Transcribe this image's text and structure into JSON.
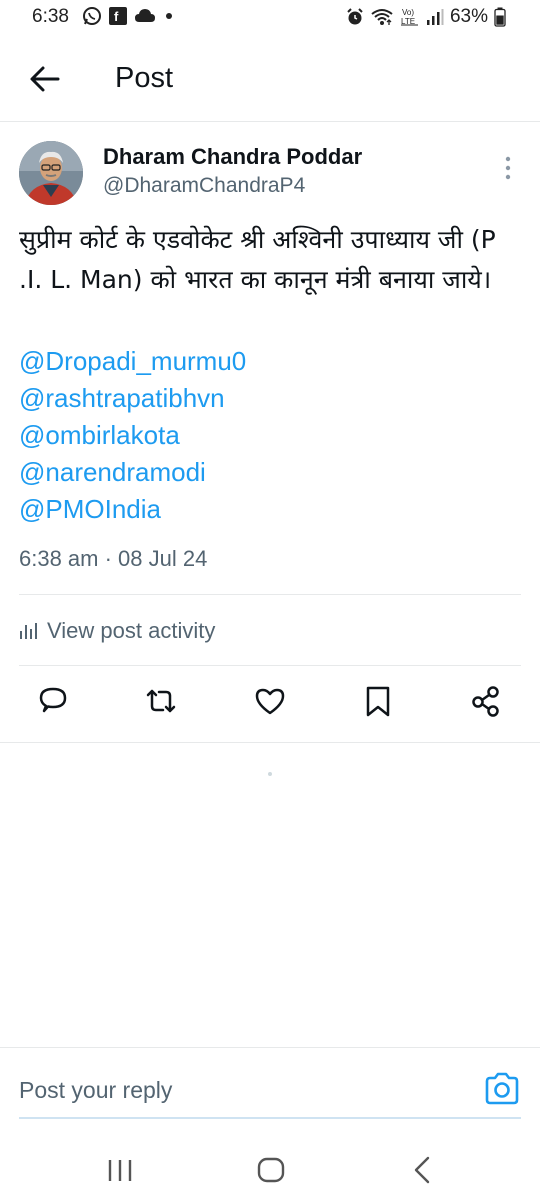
{
  "status_bar": {
    "time": "6:38",
    "battery_percent": "63%",
    "icons": [
      "whatsapp-icon",
      "gallery-icon",
      "cloud-icon",
      "dot-icon",
      "alarm-icon",
      "wifi-icon",
      "volte-icon",
      "signal-icon",
      "battery-icon"
    ],
    "volte_label": "Vo)\nLTE"
  },
  "header": {
    "title": "Post"
  },
  "post": {
    "author_name": "Dharam Chandra Poddar",
    "author_handle": "@DharamChandraP4",
    "text": "सुप्रीम कोर्ट के एडवोकेट श्री अश्विनी उपाध्याय जी (P .I. L. Man) को भारत का कानून मंत्री बनाया जाये।",
    "mentions": [
      "@Dropadi_murmu0",
      "@rashtrapatibhvn",
      "@ombirlakota",
      "@narendramodi",
      "@PMOIndia"
    ],
    "timestamp": "6:38 am · 08 Jul 24",
    "activity_label": "View post activity"
  },
  "actions": [
    "reply-icon",
    "repost-icon",
    "like-icon",
    "bookmark-icon",
    "share-icon"
  ],
  "reply": {
    "placeholder": "Post your reply"
  },
  "colors": {
    "accent": "#1d9bf0",
    "text_primary": "#0f1419",
    "text_secondary": "#536471",
    "divider": "#e7e9ea"
  }
}
